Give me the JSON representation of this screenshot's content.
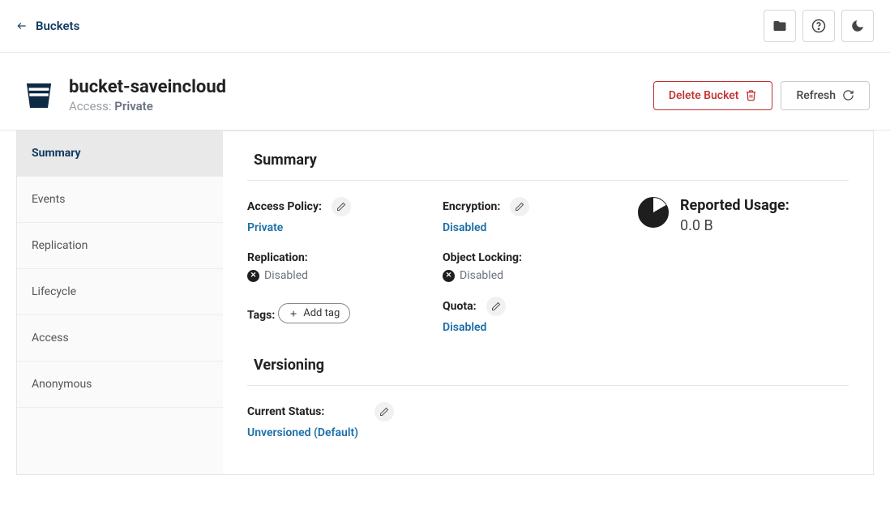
{
  "topbar": {
    "breadcrumb": "Buckets"
  },
  "header": {
    "title": "bucket-saveincloud",
    "access_label": "Access:",
    "access_value": "Private",
    "delete_label": "Delete Bucket",
    "refresh_label": "Refresh"
  },
  "sidebar": {
    "items": [
      {
        "label": "Summary",
        "active": true
      },
      {
        "label": "Events"
      },
      {
        "label": "Replication"
      },
      {
        "label": "Lifecycle"
      },
      {
        "label": "Access"
      },
      {
        "label": "Anonymous"
      }
    ]
  },
  "main": {
    "summary_title": "Summary",
    "access_policy": {
      "label": "Access Policy:",
      "value": "Private"
    },
    "replication": {
      "label": "Replication:",
      "value": "Disabled"
    },
    "tags": {
      "label": "Tags:",
      "add_label": "Add tag"
    },
    "encryption": {
      "label": "Encryption:",
      "value": "Disabled"
    },
    "object_locking": {
      "label": "Object Locking:",
      "value": "Disabled"
    },
    "quota": {
      "label": "Quota:",
      "value": "Disabled"
    },
    "usage": {
      "title": "Reported Usage:",
      "value": "0.0 B"
    },
    "versioning_title": "Versioning",
    "current_status": {
      "label": "Current Status:",
      "value": "Unversioned (Default)"
    }
  }
}
